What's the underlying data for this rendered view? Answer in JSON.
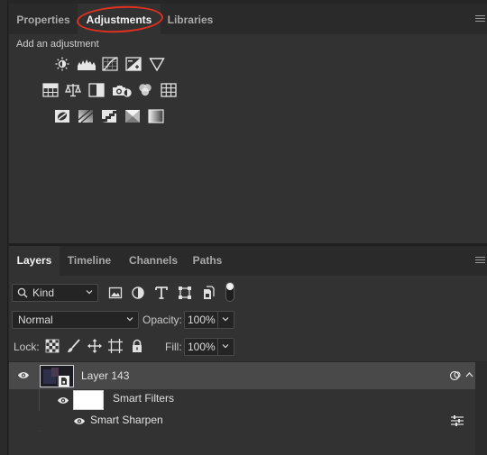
{
  "top_panel": {
    "tabs": [
      {
        "label": "Properties",
        "active": false
      },
      {
        "label": "Adjustments",
        "active": true
      },
      {
        "label": "Libraries",
        "active": false
      }
    ],
    "title": "Add an adjustment",
    "annotation_color": "#e0311f",
    "icons_row1": [
      "brightness-contrast-icon",
      "levels-icon",
      "curves-icon",
      "exposure-icon",
      "vibrance-icon"
    ],
    "icons_row2": [
      "hue-saturation-icon",
      "color-balance-icon",
      "black-white-icon",
      "photo-filter-icon",
      "channel-mixer-icon",
      "color-lookup-icon"
    ],
    "icons_row3": [
      "invert-icon",
      "posterize-icon",
      "threshold-icon",
      "selective-color-icon",
      "gradient-map-icon"
    ]
  },
  "layers_panel": {
    "tabs": [
      {
        "label": "Layers",
        "active": true
      },
      {
        "label": "Timeline",
        "active": false
      },
      {
        "label": "Channels",
        "active": false
      },
      {
        "label": "Paths",
        "active": false
      }
    ],
    "filter_kind": "Kind",
    "blend_mode": "Normal",
    "opacity_label": "Opacity:",
    "opacity_value": "100%",
    "lock_label": "Lock:",
    "fill_label": "Fill:",
    "fill_value": "100%",
    "layers": [
      {
        "name": "Layer 143"
      }
    ],
    "smart_filters_label": "Smart Filters",
    "smart_filter_items": [
      "Smart Sharpen"
    ]
  }
}
